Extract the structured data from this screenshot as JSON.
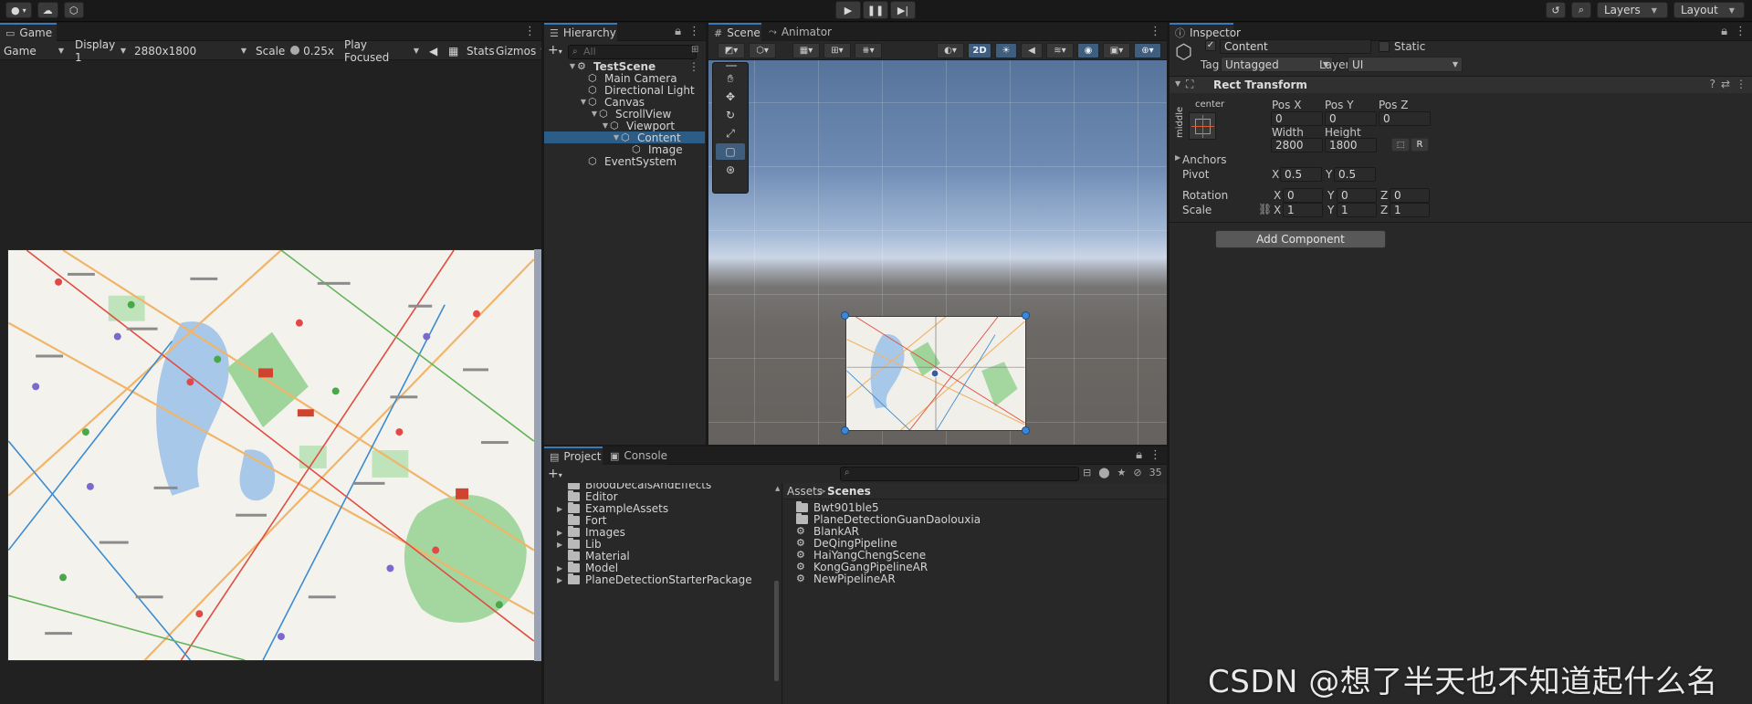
{
  "topbar": {
    "account_icon": "account-icon",
    "cloud_icon": "cloud-icon",
    "collab_icon": "collab-icon",
    "play_icon": "play-icon",
    "pause_icon": "pause-icon",
    "step_icon": "step-icon",
    "history_icon": "history-icon",
    "search_icon": "search-icon",
    "layers_label": "Layers",
    "layout_label": "Layout"
  },
  "game": {
    "tab_label": "Game",
    "view_mode": "Game",
    "display": "Display 1",
    "resolution": "2880x1800",
    "scale_label": "Scale",
    "scale_value": "0.25x",
    "play_mode": "Play Focused",
    "stats_label": "Stats",
    "gizmos_label": "Gizmos",
    "scale_slider_fraction": 0.05
  },
  "hierarchy": {
    "tab_label": "Hierarchy",
    "search_placeholder": "All",
    "items": [
      {
        "label": "TestScene",
        "depth": 0,
        "kind": "scene"
      },
      {
        "label": "Main Camera",
        "depth": 1,
        "kind": "object"
      },
      {
        "label": "Directional Light",
        "depth": 1,
        "kind": "object"
      },
      {
        "label": "Canvas",
        "depth": 1,
        "kind": "object"
      },
      {
        "label": "ScrollView",
        "depth": 2,
        "kind": "object"
      },
      {
        "label": "Viewport",
        "depth": 3,
        "kind": "object"
      },
      {
        "label": "Content",
        "depth": 4,
        "kind": "object",
        "selected": true
      },
      {
        "label": "Image",
        "depth": 5,
        "kind": "object"
      },
      {
        "label": "EventSystem",
        "depth": 1,
        "kind": "object"
      }
    ]
  },
  "scene": {
    "tab_label": "Scene",
    "animator_tab": "Animator",
    "mode_2d": "2D"
  },
  "inspector": {
    "tab_label": "Inspector",
    "object_name": "Content",
    "static_label": "Static",
    "tag_label": "Tag",
    "tag_value": "Untagged",
    "layer_label": "Layer",
    "layer_value": "UI",
    "component_title": "Rect Transform",
    "anchor_h": "center",
    "anchor_v": "middle",
    "pos_x_label": "Pos X",
    "pos_y_label": "Pos Y",
    "pos_z_label": "Pos Z",
    "pos_x": "0",
    "pos_y": "0",
    "pos_z": "0",
    "width_label": "Width",
    "height_label": "Height",
    "width": "2800",
    "height": "1800",
    "r_button": "R",
    "anchors_label": "Anchors",
    "pivot_label": "Pivot",
    "pivot_x": "0.5",
    "pivot_y": "0.5",
    "rotation_label": "Rotation",
    "rot_x": "0",
    "rot_y": "0",
    "rot_z": "0",
    "scale_label": "Scale",
    "scale_x": "1",
    "scale_y": "1",
    "scale_z": "1",
    "x_axis": "X",
    "y_axis": "Y",
    "z_axis": "Z",
    "add_component": "Add Component"
  },
  "project": {
    "tab_label": "Project",
    "console_tab": "Console",
    "hidden_count": "35",
    "tree": [
      "BloodDecalsAndEffects",
      "Editor",
      "ExampleAssets",
      "Fort",
      "Images",
      "Lib",
      "Material",
      "Model",
      "PlaneDetectionStarterPackage"
    ],
    "breadcrumb_root": "Assets",
    "breadcrumb_current": "Scenes",
    "files": [
      {
        "label": "Bwt901ble5",
        "kind": "folder"
      },
      {
        "label": "PlaneDetectionGuanDaolouxia",
        "kind": "folder"
      },
      {
        "label": "BlankAR",
        "kind": "scene"
      },
      {
        "label": "DeQingPipeline",
        "kind": "scene"
      },
      {
        "label": "HaiYangChengScene",
        "kind": "scene"
      },
      {
        "label": "KongGangPipelineAR",
        "kind": "scene"
      },
      {
        "label": "NewPipelineAR",
        "kind": "scene"
      }
    ]
  },
  "watermark": "CSDN @想了半天也不知道起什么名"
}
